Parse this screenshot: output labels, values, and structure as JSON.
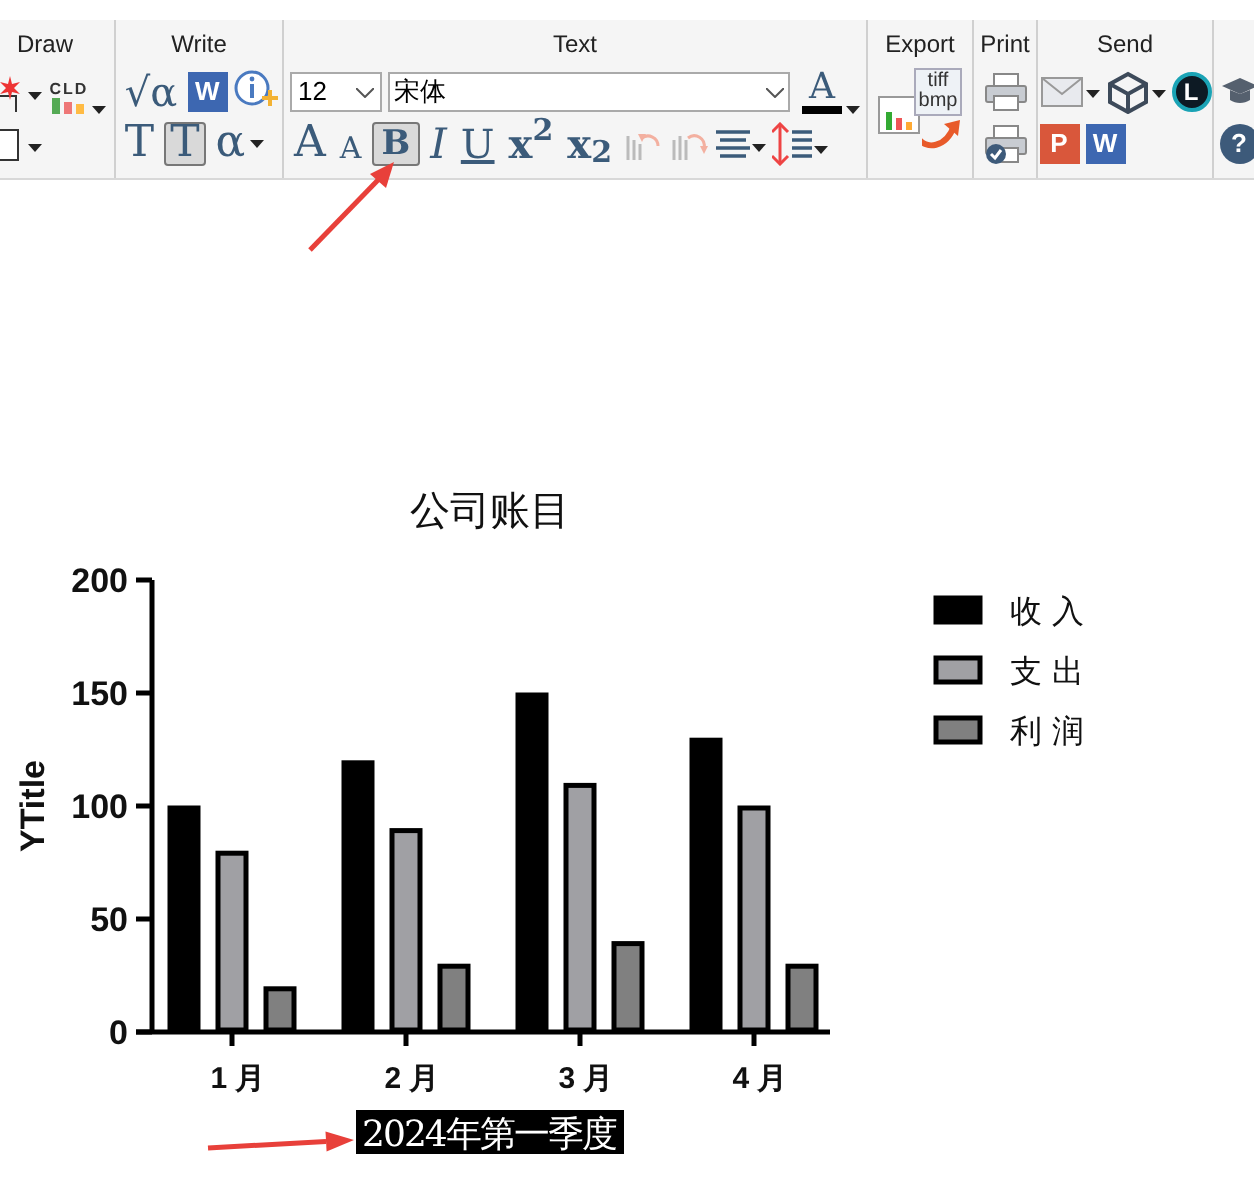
{
  "ribbon": {
    "groups": [
      {
        "title": "Draw",
        "upper": [
          {
            "kind": "star-shape"
          },
          {
            "kind": "cld",
            "text": "CLD"
          }
        ],
        "lower": [
          {
            "kind": "rect-shape"
          }
        ]
      },
      {
        "title": "Write",
        "upper": [
          {
            "kind": "math",
            "text": "√α"
          },
          {
            "kind": "word",
            "text": "W"
          },
          {
            "kind": "info"
          }
        ],
        "lower": [
          {
            "kind": "serif-t",
            "text": "T",
            "on": false
          },
          {
            "kind": "serif-t",
            "text": "T",
            "on": true
          },
          {
            "kind": "alpha",
            "text": "α",
            "on": false
          }
        ]
      },
      {
        "title": "Text",
        "upper": [
          {
            "kind": "size-field",
            "value": "12"
          },
          {
            "kind": "font-field",
            "value": "宋体"
          },
          {
            "kind": "color-a",
            "text": "A"
          }
        ],
        "lower": [
          {
            "kind": "grow",
            "text": "A",
            "on": false
          },
          {
            "kind": "shrink",
            "text": "A",
            "on": false
          },
          {
            "kind": "bold",
            "text": "B",
            "on": true
          },
          {
            "kind": "italic",
            "text": "I",
            "on": false
          },
          {
            "kind": "underline",
            "text": "U",
            "on": false
          },
          {
            "kind": "script",
            "text": "x$^{2}$",
            "on": false
          },
          {
            "kind": "script",
            "text": "x$_{2}$",
            "on": false
          },
          {
            "kind": "undo"
          },
          {
            "kind": "redo"
          },
          {
            "kind": "align"
          },
          {
            "kind": "spacing"
          }
        ]
      },
      {
        "title": "Export",
        "upper": [
          {
            "kind": "export",
            "texts": [
              "tiff",
              "bmp"
            ]
          }
        ]
      },
      {
        "title": "Print",
        "upper": [
          {
            "kind": "print"
          }
        ],
        "lower": [
          {
            "kind": "print-check"
          }
        ]
      },
      {
        "title": "Send",
        "upper": [
          {
            "kind": "mail"
          },
          {
            "kind": "cube"
          },
          {
            "kind": "circle-letter",
            "text": "L"
          }
        ],
        "lower": [
          {
            "kind": "ppt",
            "text": "P"
          },
          {
            "kind": "word",
            "text": "W"
          }
        ]
      },
      {
        "upper": [
          {
            "kind": "cap"
          }
        ],
        "lower": [
          {
            "kind": "help",
            "text": "?"
          }
        ]
      }
    ]
  },
  "graph": {
    "xlabel_selected": true,
    "chart_data": {
      "type": "bar",
      "title": "公司账目",
      "xlabel": "2024年第一季度",
      "ylabel": "YTitle",
      "categories": [
        "1 月",
        "2 月",
        "3 月",
        "4 月"
      ],
      "ylim": [
        0,
        200
      ],
      "legend": true,
      "yticks": [
        0,
        50,
        100,
        150,
        200
      ],
      "series": [
        {
          "name": "收 入",
          "color": "#000000",
          "values": [
            100,
            120,
            150,
            130
          ]
        },
        {
          "name": "支 出",
          "color": "#a0a0a4",
          "values": [
            80,
            90,
            110,
            100
          ]
        },
        {
          "name": "利 润",
          "color": "#808080",
          "values": [
            20,
            30,
            40,
            30
          ]
        }
      ]
    }
  }
}
